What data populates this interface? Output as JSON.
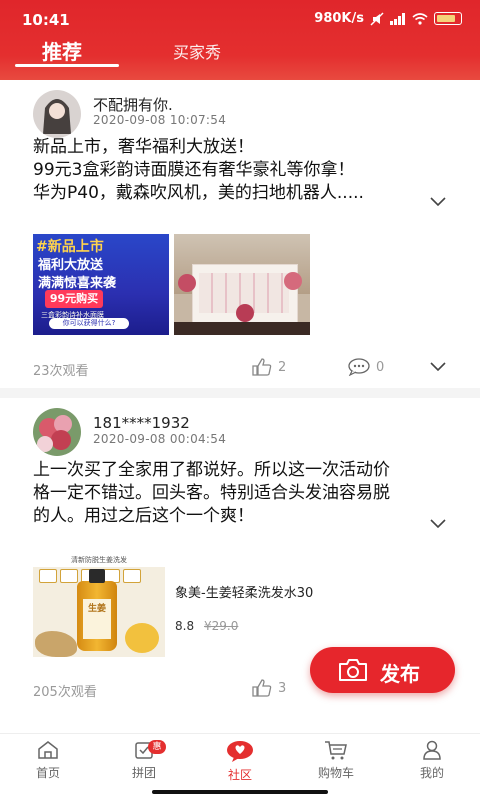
{
  "status_bar": {
    "time": "10:41",
    "net_speed": "980K/s",
    "network_type": "4G"
  },
  "tabs": [
    {
      "label": "推荐",
      "active": true
    },
    {
      "label": "买家秀",
      "active": false
    }
  ],
  "posts": [
    {
      "username": "不配拥有你.",
      "date": "2020-09-08 10:07:54",
      "text_lines": [
        "新品上市，奢华福利大放送！",
        "99元3盒彩韵诗面膜还有奢华豪礼等你拿！",
        "华为P40，戴森吹风机，美的扫地机器人.....",
        ""
      ],
      "promo_image": {
        "line1": "#新品上市",
        "line2": "福利大放送",
        "line3": "满满惊喜来袭",
        "price": "99元购买",
        "sub": "三盒彩韵诗补水面膜",
        "button": "你可以获得什么?"
      },
      "views": "23次观看",
      "likes": "2",
      "comments": "0"
    },
    {
      "username": "181****1932",
      "date": "2020-09-08 00:04:54",
      "text_lines": [
        "上一次买了全家用了都说好。所以这一次活动价",
        "格一定不错过。回头客。特别适合头发油容易脱",
        "的人。用过之后这个一个爽！"
      ],
      "product": {
        "name": "象美-生姜轻柔洗发水30",
        "price": "8.8",
        "original_price": "¥29.0",
        "image_header": "清新防脱生姜洗发",
        "image_label": "生姜"
      },
      "views": "205次观看",
      "likes": "3"
    }
  ],
  "publish_button": {
    "label": "发布"
  },
  "bottom_nav": [
    {
      "label": "首页",
      "icon": "home-icon",
      "active": false
    },
    {
      "label": "拼团",
      "icon": "group-buy-icon",
      "active": false,
      "badge": "惠"
    },
    {
      "label": "社区",
      "icon": "community-icon",
      "active": true
    },
    {
      "label": "购物车",
      "icon": "cart-icon",
      "active": false
    },
    {
      "label": "我的",
      "icon": "profile-icon",
      "active": false
    }
  ],
  "colors": {
    "brand_red": "#e42f2f",
    "muted_text": "#999999"
  }
}
